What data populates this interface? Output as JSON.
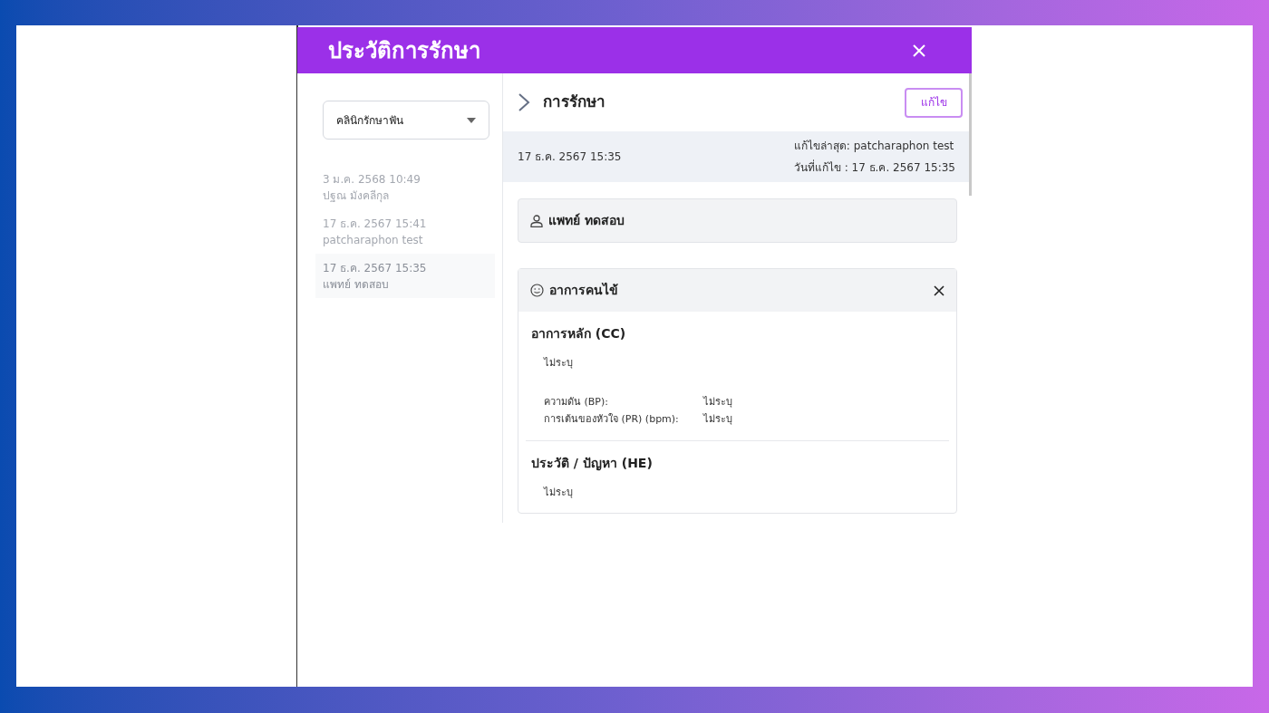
{
  "dialog": {
    "title": "ประวัติการรักษา"
  },
  "clinic_select": {
    "value": "คลินิกรักษาฟัน"
  },
  "history": [
    {
      "date": "3 ม.ค. 2568 10:49",
      "name": "ปฐณ มังคลีกุล",
      "selected": false
    },
    {
      "date": "17 ธ.ค. 2567 15:41",
      "name": "patcharaphon test",
      "selected": false
    },
    {
      "date": "17 ธ.ค. 2567 15:35",
      "name": "แพทย์ ทดสอบ",
      "selected": true
    }
  ],
  "record": {
    "title": "การรักษา",
    "edit_button": "แก้ไข",
    "date": "17 ธ.ค. 2567 15:35",
    "last_edited_by": "แก้ไขล่าสุด: patcharaphon test",
    "edited_date": "วันที่แก้ไข : 17 ธ.ค. 2567 15:35",
    "doctor": "แพทย์ ทดสอบ"
  },
  "symptoms": {
    "title": "อาการคนไข้",
    "sections": [
      {
        "heading": "อาการหลัก (CC)",
        "text": "ไม่ระบุ",
        "fields": [
          {
            "label": "ความดัน (BP):",
            "value": "ไม่ระบุ"
          },
          {
            "label": "การเต้นของหัวใจ (PR) (bpm):",
            "value": "ไม่ระบุ"
          }
        ]
      },
      {
        "heading": "ประวัติ / ปัญหา (HE)",
        "text": "ไม่ระบุ"
      }
    ]
  }
}
